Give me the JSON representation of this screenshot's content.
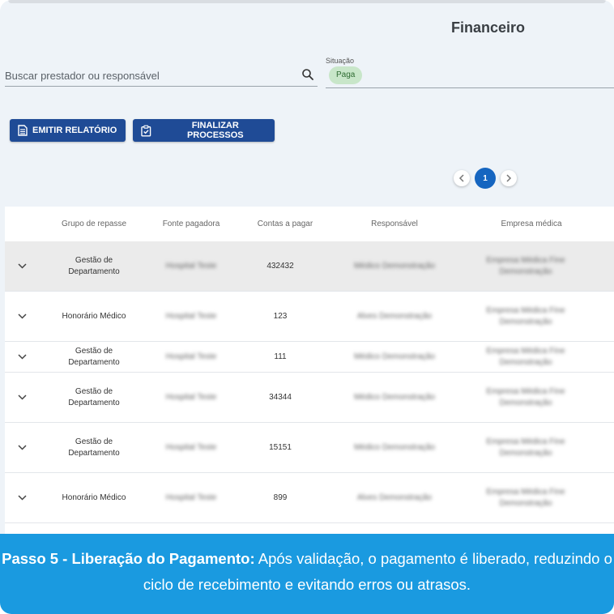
{
  "header": {
    "title": "Financeiro"
  },
  "search": {
    "placeholder": "Buscar prestador ou responsável"
  },
  "filter": {
    "label": "Situação",
    "chip": "Paga",
    "chip_color": "#c8e6c9"
  },
  "actions": {
    "emitir_label": "EMITIR RELATÓRIO",
    "finalizar_label": "FINALIZAR PROCESSOS",
    "button_color": "#1f4b96"
  },
  "pagination": {
    "current": "1"
  },
  "table": {
    "headers": [
      "Grupo de repasse",
      "Fonte pagadora",
      "Contas a pagar",
      "Responsável",
      "Empresa médica"
    ],
    "rows": [
      {
        "grupo": "Gestão de Departamento",
        "fonte": "Hospital Teste",
        "contas": "432432",
        "responsavel": "Médico Demonstração",
        "empresa": "Empresa Médica Fine Demonstração"
      },
      {
        "grupo": "Honorário Médico",
        "fonte": "Hospital Teste",
        "contas": "123",
        "responsavel": "Alves Demonstração",
        "empresa": "Empresa Médica Fine Demonstração"
      },
      {
        "grupo": "Gestão de Departamento",
        "fonte": "Hospital Teste",
        "contas": "111",
        "responsavel": "Médico Demonstração",
        "empresa": "Empresa Médica Fine Demonstração"
      },
      {
        "grupo": "Gestão de Departamento",
        "fonte": "Hospital Teste",
        "contas": "34344",
        "responsavel": "Médico Demonstração",
        "empresa": "Empresa Médica Fine Demonstração"
      },
      {
        "grupo": "Gestão de Departamento",
        "fonte": "Hospital Teste",
        "contas": "15151",
        "responsavel": "Médico Demonstração",
        "empresa": "Empresa Médica Fine Demonstração"
      },
      {
        "grupo": "Honorário Médico",
        "fonte": "Hospital Teste",
        "contas": "899",
        "responsavel": "Alves Demonstração",
        "empresa": "Empresa Médica Fine Demonstração"
      }
    ]
  },
  "banner": {
    "bold": "Passo 5 - Liberação do Pagamento:",
    "text": " Após validação, o pagamento é liberado, reduzindo o ciclo de recebimento e evitando erros ou atrasos.",
    "color": "#1a9ae0"
  }
}
